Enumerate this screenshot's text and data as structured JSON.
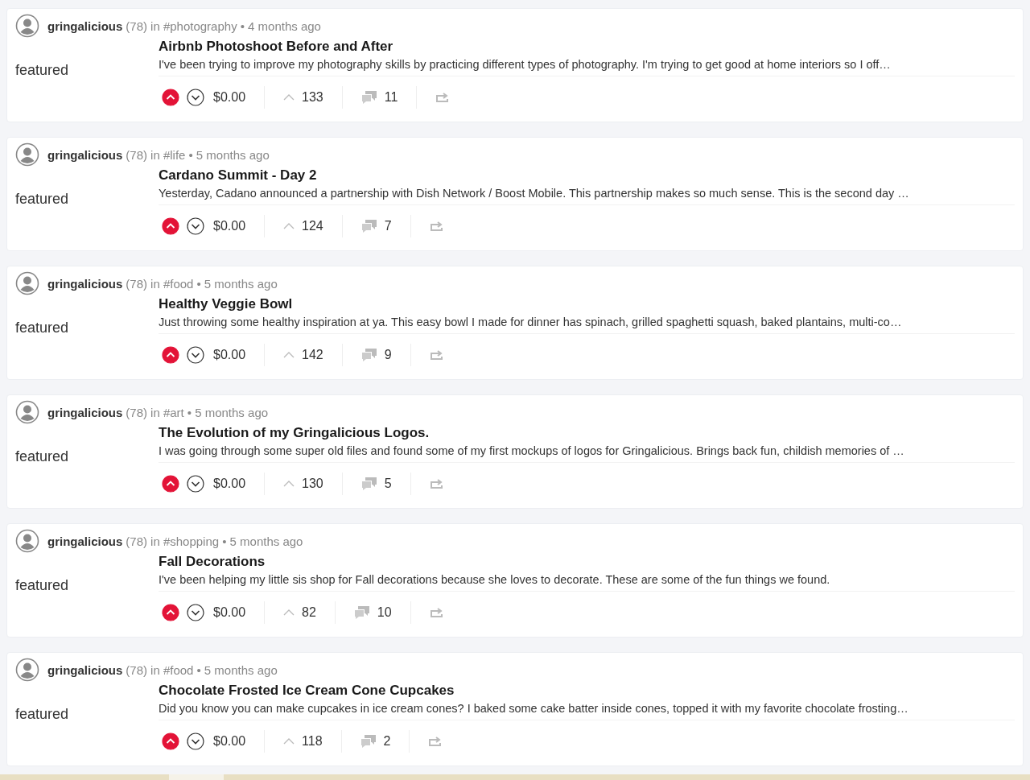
{
  "posts": [
    {
      "author": "gringalicious",
      "reputation": "(78)",
      "community": "in #photography",
      "age": "• 4 months ago",
      "label": "featured",
      "title": "Airbnb Photoshoot Before and After",
      "snippet": "I've been trying to improve my photography skills by practicing different types of photography. I'm trying to get good at home interiors so I off…",
      "upvoted": true,
      "payout": "$0.00",
      "votes": "133",
      "comments": "11"
    },
    {
      "author": "gringalicious",
      "reputation": "(78)",
      "community": "in #life",
      "age": "• 5 months ago",
      "label": "featured",
      "title": "Cardano Summit - Day 2",
      "snippet": "Yesterday, Cadano announced a partnership with Dish Network / Boost Mobile. This partnership makes so much sense. This is the second day …",
      "upvoted": true,
      "payout": "$0.00",
      "votes": "124",
      "comments": "7"
    },
    {
      "author": "gringalicious",
      "reputation": "(78)",
      "community": "in #food",
      "age": "• 5 months ago",
      "label": "featured",
      "title": "Healthy Veggie Bowl",
      "snippet": "Just throwing some healthy inspiration at ya. This easy bowl I made for dinner has spinach, grilled spaghetti squash, baked plantains, multi-co…",
      "upvoted": true,
      "payout": "$0.00",
      "votes": "142",
      "comments": "9"
    },
    {
      "author": "gringalicious",
      "reputation": "(78)",
      "community": "in #art",
      "age": "• 5 months ago",
      "label": "featured",
      "title": "The Evolution of my Gringalicious Logos.",
      "snippet": "I was going through some super old files and found some of my first mockups of logos for Gringalicious. Brings back fun, childish memories of …",
      "upvoted": true,
      "payout": "$0.00",
      "votes": "130",
      "comments": "5"
    },
    {
      "author": "gringalicious",
      "reputation": "(78)",
      "community": "in #shopping",
      "age": "• 5 months ago",
      "label": "featured",
      "title": "Fall Decorations",
      "snippet": "I've been helping my little sis shop for Fall decorations because she loves to decorate. These are some of the fun things we found.",
      "upvoted": true,
      "payout": "$0.00",
      "votes": "82",
      "comments": "10"
    },
    {
      "author": "gringalicious",
      "reputation": "(78)",
      "community": "in #food",
      "age": "• 5 months ago",
      "label": "featured",
      "title": "Chocolate Frosted Ice Cream Cone Cupcakes",
      "snippet": "Did you know you can make cupcakes in ice cream cones? I baked some cake batter inside cones, topped it with my favorite chocolate frosting…",
      "upvoted": true,
      "payout": "$0.00",
      "votes": "118",
      "comments": "2"
    }
  ]
}
